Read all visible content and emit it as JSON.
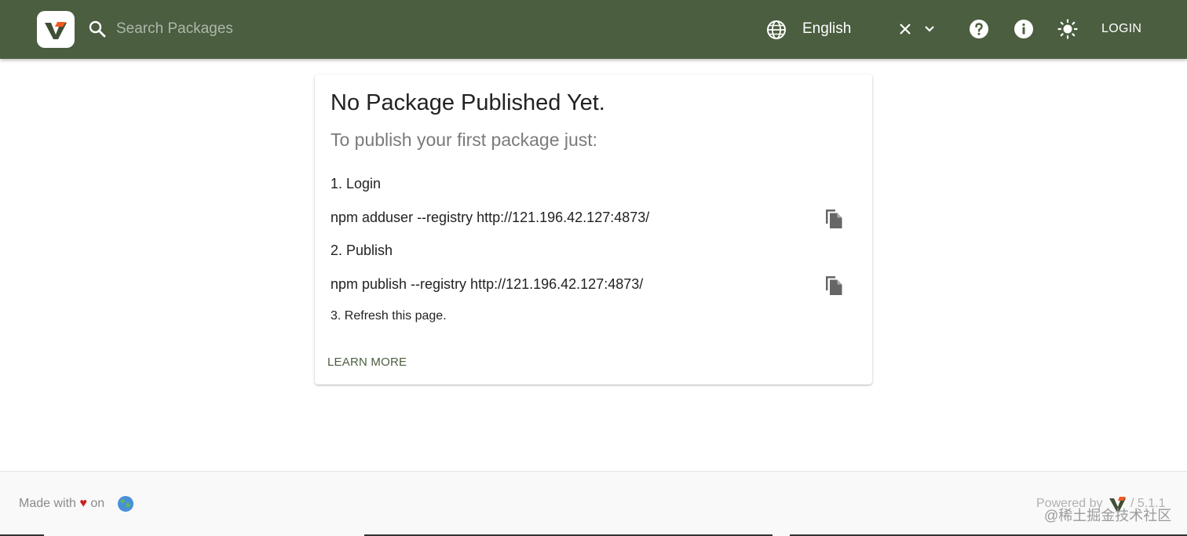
{
  "header": {
    "search_placeholder": "Search Packages",
    "language": "English",
    "login_label": "LOGIN",
    "icons": [
      "verdaccio-logo-icon",
      "search-icon",
      "globe-icon",
      "clear-icon",
      "chevron-down-icon",
      "help-icon",
      "info-icon",
      "theme-icon"
    ],
    "colors": {
      "bar": "#4b5e40",
      "text": "#ffffff"
    }
  },
  "card": {
    "title": "No Package Published Yet.",
    "subtitle": "To publish your first package just:",
    "steps": [
      {
        "label": "1. Login",
        "command": "npm adduser --registry http://121.196.42.127:4873/"
      },
      {
        "label": "2. Publish",
        "command": "npm publish --registry http://121.196.42.127:4873/"
      }
    ],
    "step3": "3. Refresh this page.",
    "learn_more": "LEARN MORE"
  },
  "footer": {
    "made_with": "Made with",
    "heart": "♥",
    "on": "on",
    "powered_by": "Powered by",
    "version": "/ 5.1.1",
    "watermark": "@稀土掘金技术社区"
  }
}
